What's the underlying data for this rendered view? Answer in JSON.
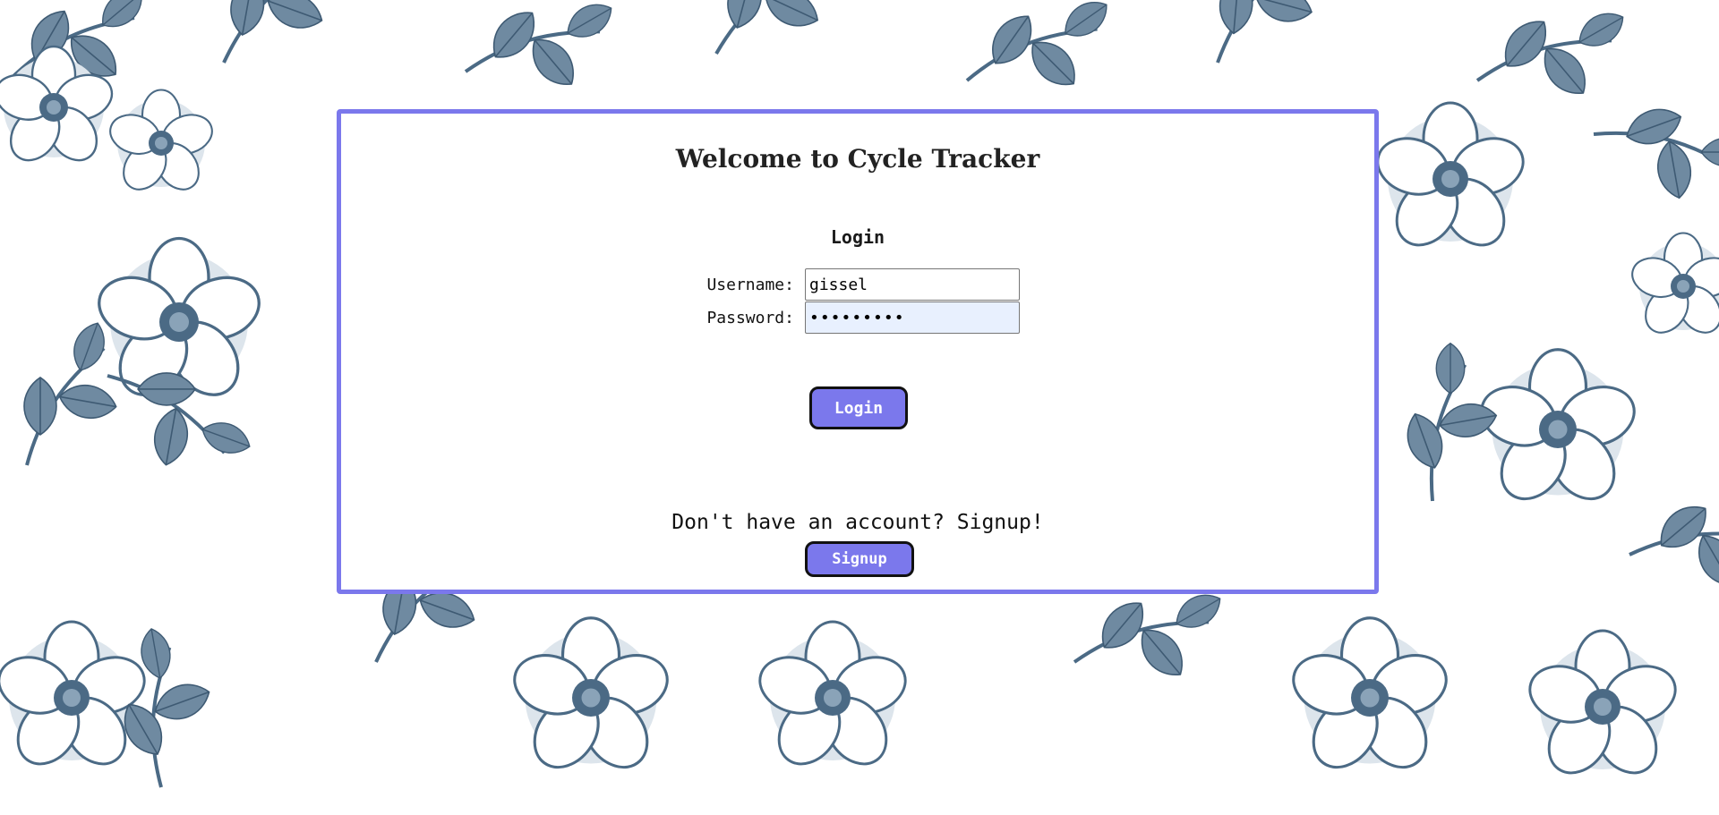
{
  "page": {
    "title": "Welcome to Cycle Tracker"
  },
  "login": {
    "heading": "Login",
    "username_label": "Username:",
    "username_value": "gissel",
    "password_label": "Password:",
    "password_value": "•••••••••",
    "button_label": "Login"
  },
  "signup": {
    "prompt": "Don't have an account? Signup!",
    "button_label": "Signup"
  },
  "colors": {
    "accent": "#7b78ec",
    "floral": "#4b6a85",
    "autofill_background": "#e8f0fe"
  },
  "background": {
    "pattern_icon": "floral-peony-pattern"
  }
}
